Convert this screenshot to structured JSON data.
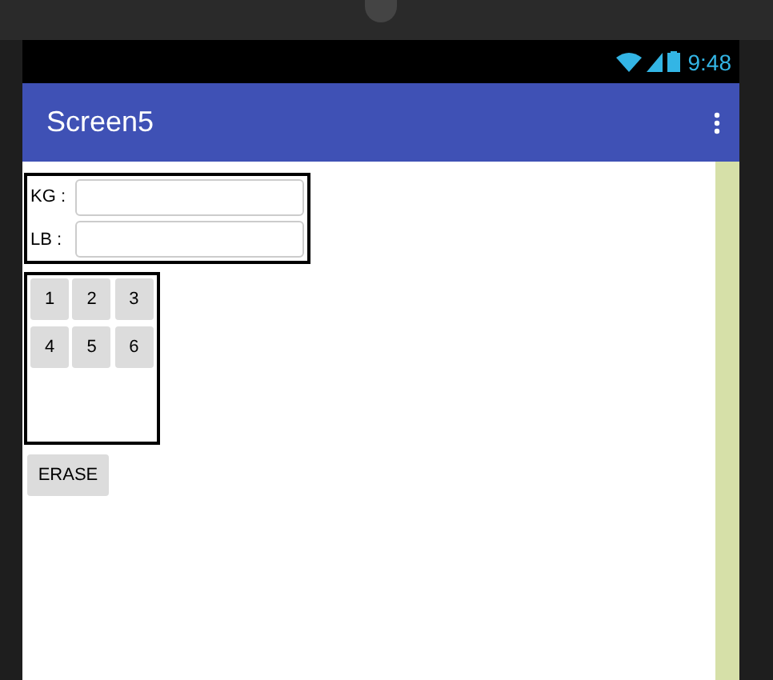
{
  "status_bar": {
    "time": "9:48"
  },
  "app_bar": {
    "title": "Screen5"
  },
  "form": {
    "fields": [
      {
        "label": "KG :"
      },
      {
        "label": "LB :"
      }
    ]
  },
  "keypad": {
    "keys": [
      "1",
      "2",
      "3",
      "4",
      "5",
      "6"
    ]
  },
  "buttons": [
    "ERASE"
  ]
}
